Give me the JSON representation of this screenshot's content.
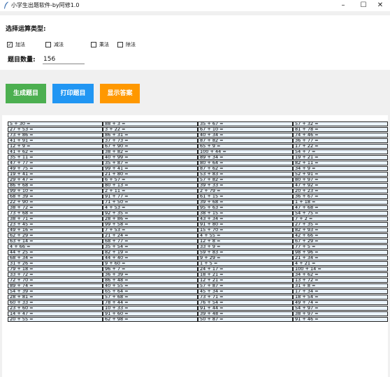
{
  "window": {
    "title": "小学生出题软件-by阿修1.0",
    "minimize": "–",
    "maximize": "☐",
    "close": "✕"
  },
  "controls": {
    "op_type_label": "选择运算类型:",
    "ops": [
      {
        "label": "加法",
        "checked": true
      },
      {
        "label": "减法",
        "checked": false
      },
      {
        "label": "乘法",
        "checked": false
      },
      {
        "label": "除法",
        "checked": false
      }
    ],
    "count_label": "题目数量:",
    "count_value": "156"
  },
  "buttons": {
    "generate": "生成题目",
    "print": "打印题目",
    "show_answers": "显示答案"
  },
  "colors": {
    "generate": "#4caf50",
    "print": "#2196f3",
    "show_answers": "#ff9800"
  },
  "questions": [
    [
      "5 + 30 =",
      "27 + 53 =",
      "73 + 86 =",
      "41 + 91 =",
      "12 + 9 =",
      "41 + 62 =",
      "35 + 11 =",
      "47 + 77 =",
      "49 + 75 =",
      "19 + 41 =",
      "29 + 47 =",
      "86 + 68 =",
      "99 + 10 =",
      "68 + 39 =",
      "22 + 90 =",
      "38 + 72 =",
      "73 + 68 =",
      "38 + 71 =",
      "23 + 45 =",
      "49 + 16 =",
      "62 + 29 =",
      "63 + 14 =",
      "4 + 66 =",
      "44 + 25 =",
      "68 + 34 =",
      "31 + 26 =",
      "79 + 18 =",
      "33 + 72 =",
      "72 + 70 =",
      "89 + 74 =",
      "54 + 39 =",
      "28 + 81 =",
      "60 + 33 =",
      "23 + 60 =",
      "14 + 47 =",
      "20 + 55 ="
    ],
    [
      "88 + 3 =",
      "3 + 22 =",
      "86 + 31 =",
      "37 + 73 =",
      "67 + 90 =",
      "38 + 82 =",
      "40 + 99 =",
      "35 + 87 =",
      "99 + 41 =",
      "21 + 80 =",
      "6 + 57 =",
      "80 + 13 =",
      "2 + 11 =",
      "91 + 77 =",
      "71 + 50 =",
      "4 + 53 =",
      "92 + 35 =",
      "28 + 86 =",
      "99 + 58 =",
      "7 + 53 =",
      "21 + 24 =",
      "68 + 77 =",
      "35 + 54 =",
      "82 + 19 =",
      "44 + 40 =",
      "9 + 60 =",
      "96 + 7 =",
      "36 + 39 =",
      "86 + 48 =",
      "40 + 55 =",
      "65 + 64 =",
      "57 + 68 =",
      "78 + 44 =",
      "10 + 33 =",
      "91 + 60 =",
      "62 + 98 ="
    ],
    [
      "35 + 67 =",
      "67 + 10 =",
      "40 + 34 =",
      "87 + 82 =",
      "65 + 9 =",
      "100 + 44 =",
      "89 + 34 =",
      "80 + 64 =",
      "87 + 62 =",
      "53 + 83 =",
      "57 + 82 =",
      "39 + 33 =",
      "2 + 79 =",
      "61 + 15 =",
      "39 + 68 =",
      "95 + 63 =",
      "38 + 15 =",
      "43 + 34 =",
      "91 + 80 =",
      "15 + 70 =",
      "4 + 55 =",
      "12 + 8 =",
      "33 + 9 =",
      "59 + 83 =",
      "9 + 29 =",
      "1 + 5 =",
      "24 + 17 =",
      "18 + 21 =",
      "12 + 21 =",
      "57 + 87 =",
      "45 + 34 =",
      "73 + 71 =",
      "76 + 54 =",
      "91 + 44 =",
      "39 + 48 =",
      "50 + 87 ="
    ],
    [
      "57 + 32 =",
      "81 + 78 =",
      "74 + 46 =",
      "36 + 77 =",
      "17 + 22 =",
      "54 + 7 =",
      "19 + 21 =",
      "82 + 11 =",
      "34 + 9 =",
      "52 + 91 =",
      "80 + 97 =",
      "47 + 92 =",
      "20 + 23 =",
      "36 + 67 =",
      "1 + 18 =",
      "47 + 68 =",
      "54 + 75 =",
      "7 + 2 =",
      "27 + 35 =",
      "82 + 93 =",
      "42 + 66 =",
      "67 + 29 =",
      "77 + 5 =",
      "98 + 96 =",
      "21 + 34 =",
      "4 + 21 =",
      "100 + 14 =",
      "34 + 62 =",
      "13 + 72 =",
      "31 + 8 =",
      "17 + 34 =",
      "18 + 54 =",
      "49 + 74 =",
      "54 + 97 =",
      "38 + 97 =",
      "91 + 46 ="
    ]
  ]
}
